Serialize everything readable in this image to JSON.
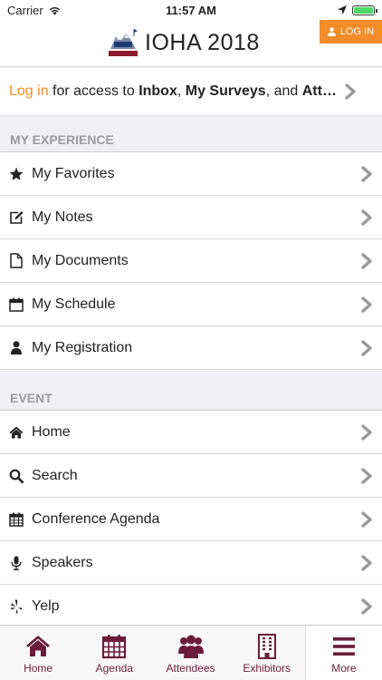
{
  "status_bar": {
    "carrier": "Carrier",
    "time": "11:57 AM"
  },
  "header": {
    "title": "IOHA 2018",
    "login_button": "LOG IN"
  },
  "login_prompt": {
    "link": "Log in",
    "pre": " for access to ",
    "item1": "Inbox",
    "sep1": ", ",
    "item2": "My Surveys",
    "sep2": ", and ",
    "item3": "Att",
    "ellipsis": "…"
  },
  "sections": {
    "my_experience": {
      "title": "MY EXPERIENCE",
      "items": [
        {
          "label": "My Favorites",
          "icon": "star-icon"
        },
        {
          "label": "My Notes",
          "icon": "edit-icon"
        },
        {
          "label": "My Documents",
          "icon": "document-icon"
        },
        {
          "label": "My Schedule",
          "icon": "calendar-icon"
        },
        {
          "label": "My Registration",
          "icon": "user-icon"
        }
      ]
    },
    "event": {
      "title": "EVENT",
      "items": [
        {
          "label": "Home",
          "icon": "home-icon"
        },
        {
          "label": "Search",
          "icon": "search-icon"
        },
        {
          "label": "Conference Agenda",
          "icon": "calendar-grid-icon"
        },
        {
          "label": "Speakers",
          "icon": "microphone-icon"
        },
        {
          "label": "Yelp",
          "icon": "yelp-icon"
        }
      ]
    }
  },
  "tabs": [
    {
      "label": "Home",
      "icon": "home-icon"
    },
    {
      "label": "Agenda",
      "icon": "calendar-icon"
    },
    {
      "label": "Attendees",
      "icon": "group-icon"
    },
    {
      "label": "Exhibitors",
      "icon": "building-icon"
    },
    {
      "label": "More",
      "icon": "menu-icon",
      "active": true
    }
  ],
  "colors": {
    "accent": "#f28c28",
    "brand": "#6b1d3a",
    "chevron": "#999999"
  }
}
